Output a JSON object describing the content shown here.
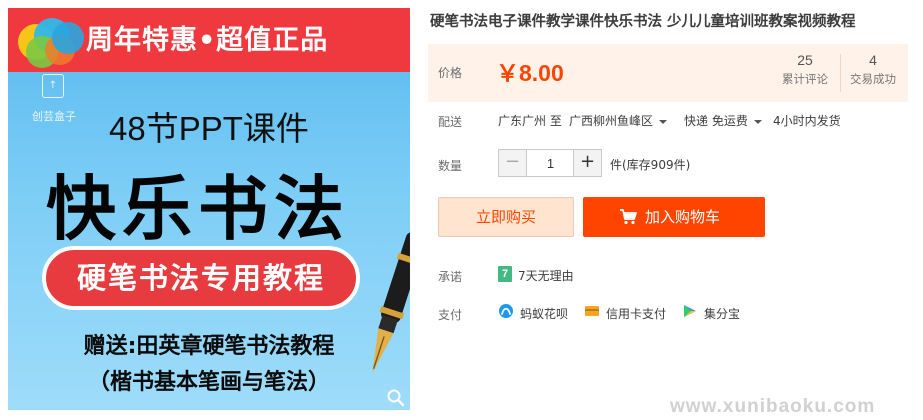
{
  "product_image": {
    "banner_text": "周年特惠•超值正品",
    "logo_text": "创芸盒子",
    "course_count_text": "48节PPT课件",
    "big_title": "快乐书法",
    "ribbon_text": "硬笔书法专用教程",
    "gift_line1": "赠送:田英章硬笔书法教程",
    "gift_line2": "（楷书基本笔画与笔法）",
    "zoom_icon": "magnifier-icon"
  },
  "product": {
    "title": "硬笔书法电子课件教学课件快乐书法 少儿儿童培训班教案视频教程"
  },
  "price_box": {
    "label": "价格",
    "value": "￥8.00",
    "reviews_count": "25",
    "reviews_label": "累计评论",
    "deals_count": "4",
    "deals_label": "交易成功"
  },
  "shipping": {
    "label": "配送",
    "from": "广东广州 至",
    "to": "广西柳州鱼峰区",
    "method": "快递 免运费",
    "dispatch": "4小时内发货"
  },
  "quantity": {
    "label": "数量",
    "minus": "−",
    "value": "1",
    "plus": "+",
    "stock_text": "件(库存909件)"
  },
  "actions": {
    "buy_now": "立即购买",
    "add_to_cart": "加入购物车"
  },
  "promise": {
    "label": "承诺",
    "badge": "7",
    "text": "7天无理由"
  },
  "payment": {
    "label": "支付",
    "methods": [
      "蚂蚁花呗",
      "信用卡支付",
      "集分宝"
    ]
  },
  "watermark": "www.xunibaoku.com",
  "colors": {
    "accent": "#ff4400",
    "price_bg": "#fff2e8",
    "banner_red": "#f0393f",
    "image_blue": "#56b8ee"
  }
}
